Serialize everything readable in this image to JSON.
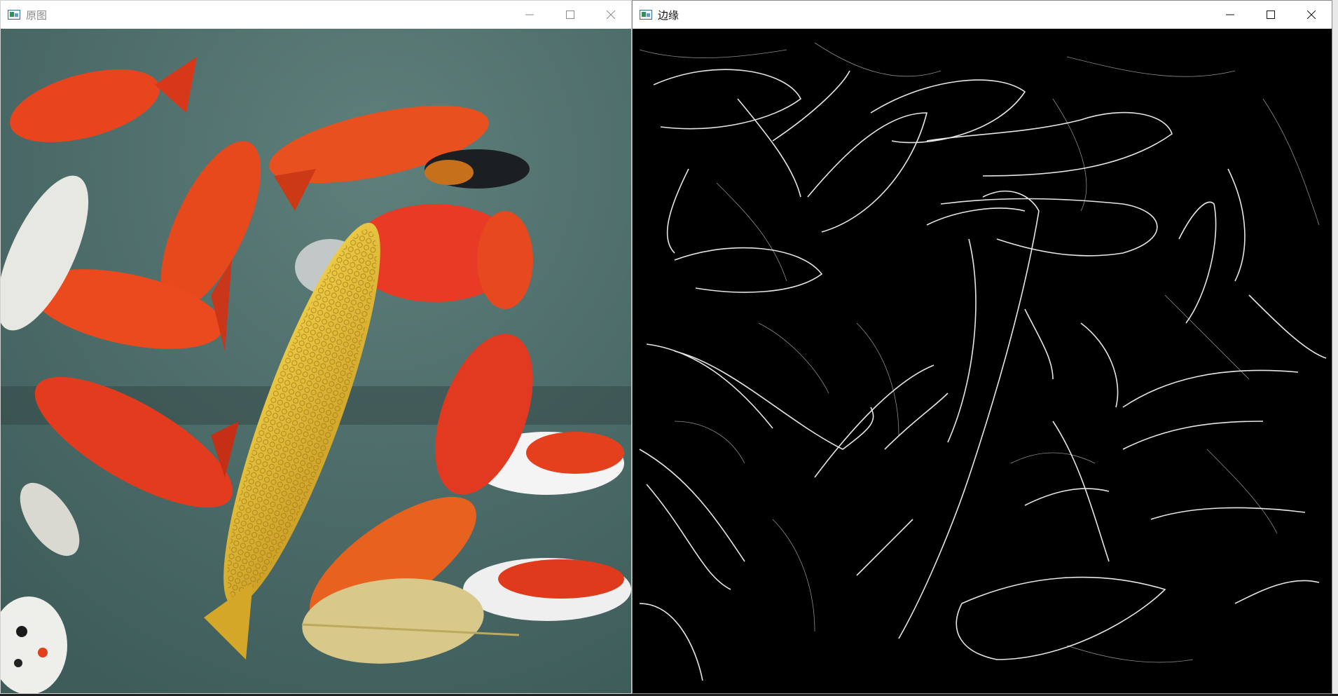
{
  "windows": [
    {
      "title": "原图",
      "icon": "opencv-window-icon",
      "controls": [
        "minimize-icon",
        "maximize-icon",
        "close-icon"
      ]
    },
    {
      "title": "边缘",
      "icon": "opencv-window-icon",
      "controls": [
        "minimize-icon",
        "maximize-icon",
        "close-icon"
      ]
    }
  ],
  "colors": {
    "original_bg": "#4b6b69",
    "edges_bg": "#000000",
    "goldfish": "#e8441e",
    "koi_yellow": "#e0b531",
    "edge_line": "#ffffff"
  }
}
